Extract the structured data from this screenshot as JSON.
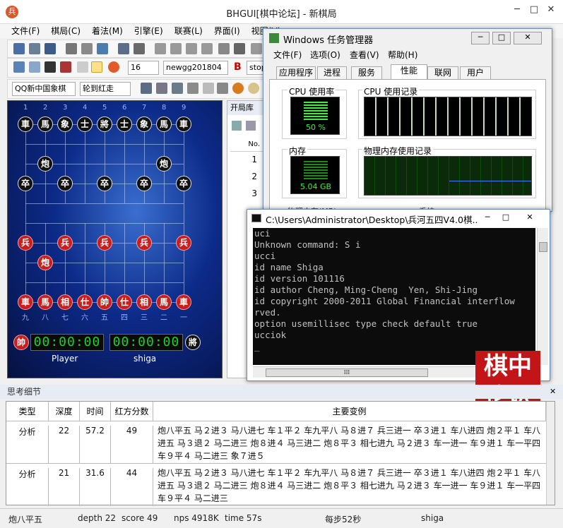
{
  "window": {
    "title": "BHGUI[棋中论坛] - 新棋局",
    "icon": "兵",
    "min": "─",
    "max": "□",
    "close": "✕"
  },
  "menu": [
    "文件(F)",
    "棋局(C)",
    "着法(M)",
    "引擎(E)",
    "联赛(L)",
    "界面(I)",
    "视图(V)"
  ],
  "toolbar": {
    "depth": "16",
    "book": "newgg201804",
    "stop": "stop",
    "book_select": "QQ新中国象棋",
    "turn_select": "轮到红走",
    "b_label": "B"
  },
  "board": {
    "black_top": [
      "車",
      "馬",
      "象",
      "士",
      "將",
      "士",
      "象",
      "馬",
      "車"
    ],
    "black_cannon": "炮",
    "black_pawn": "卒",
    "red_bottom": [
      "車",
      "馬",
      "相",
      "仕",
      "帥",
      "仕",
      "相",
      "馬",
      "車"
    ],
    "red_cannon": "炮",
    "red_pawn": "兵",
    "top_numbers": [
      "1",
      "2",
      "3",
      "4",
      "5",
      "6",
      "7",
      "8",
      "9"
    ],
    "bottom_numbers": [
      "九",
      "八",
      "七",
      "六",
      "五",
      "四",
      "三",
      "二",
      "一"
    ],
    "red_badge": "帥",
    "black_badge": "將",
    "clock_red": "00:00:00",
    "clock_black": "00:00:00",
    "player_red": "Player",
    "player_black": "shiga"
  },
  "library": {
    "title": "开局库",
    "col_no": "No.",
    "rows": [
      "1",
      "2",
      "3"
    ]
  },
  "taskmgr": {
    "title": "Windows 任务管理器",
    "menu": [
      "文件(F)",
      "选项(O)",
      "查看(V)",
      "帮助(H)"
    ],
    "tabs": [
      "应用程序",
      "进程",
      "服务",
      "性能",
      "联网",
      "用户"
    ],
    "cpu_usage_label": "CPU 使用率",
    "cpu_value": "50 %",
    "cpu_history_label": "CPU 使用记录",
    "mem_label": "内存",
    "mem_value": "5.04 GB",
    "mem_history_label": "物理内存使用记录",
    "cut_label1": "物理内存(MB)",
    "cut_label2": "系统"
  },
  "cmd": {
    "title": "C:\\Users\\Administrator\\Desktop\\兵河五四V4.0棋...",
    "lines": [
      "uci",
      "Unknown command: S i",
      "ucci",
      "id name Shiga",
      "id version 101116",
      "id author Cheng, Ming-Cheng  Yen, Shi-Jing",
      "id copyright 2000-2011 Global Financial interflow",
      "rved.",
      "option usemillisec type check default true",
      "ucciok",
      "_"
    ]
  },
  "logo": {
    "c1": "棋",
    "c2": "中",
    "c3": "论",
    "c4": "坛"
  },
  "think": {
    "title": "思考细节",
    "headers": [
      "类型",
      "深度",
      "时间",
      "红方分数",
      "主要变例"
    ],
    "rows": [
      {
        "type": "分析",
        "depth": "22",
        "time": "57.2",
        "score": "49",
        "pv": "炮八平五 马２进３ 马八进七 车１平２ 车九平八 马８进７ 兵三进一 卒３进１ 车八进四 炮２平１ 车八进五 马３退２ 马二进三 炮８进４ 马三进二 炮８平３ 相七进九 马２进３ 车一进一 车９进１ 车一平四 车９平４ 马二进三 象７进５"
      },
      {
        "type": "分析",
        "depth": "21",
        "time": "31.6",
        "score": "44",
        "pv": "炮八平五 马２进３ 马八进七 车１平２ 车九平八 马８进７ 兵三进一 卒３进１ 车八进四 炮２平１ 车八进五 马３退２ 马二进三 炮８进４ 马三进二 炮８平３ 相七进九 马２进３ 车一进一 车９进１ 车一平四 车９平４ 马二进三"
      }
    ]
  },
  "status": {
    "move": "炮八平五",
    "depth": "depth 22",
    "score": "score 49",
    "nps": "nps 4918K",
    "time": "time 57s",
    "per_move": "每步52秒",
    "engine": "shiga"
  }
}
